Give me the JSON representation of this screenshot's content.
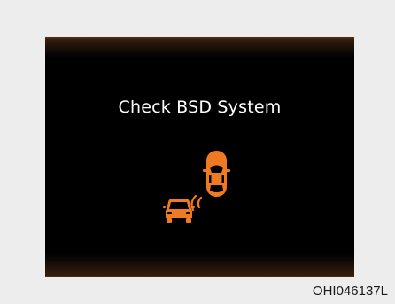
{
  "display": {
    "message": "Check BSD System",
    "icon": "blind-spot-detection-warning-icon",
    "icon_color": "#f07a22",
    "background_color": "#000000"
  },
  "figure_code": "OHI046137L"
}
